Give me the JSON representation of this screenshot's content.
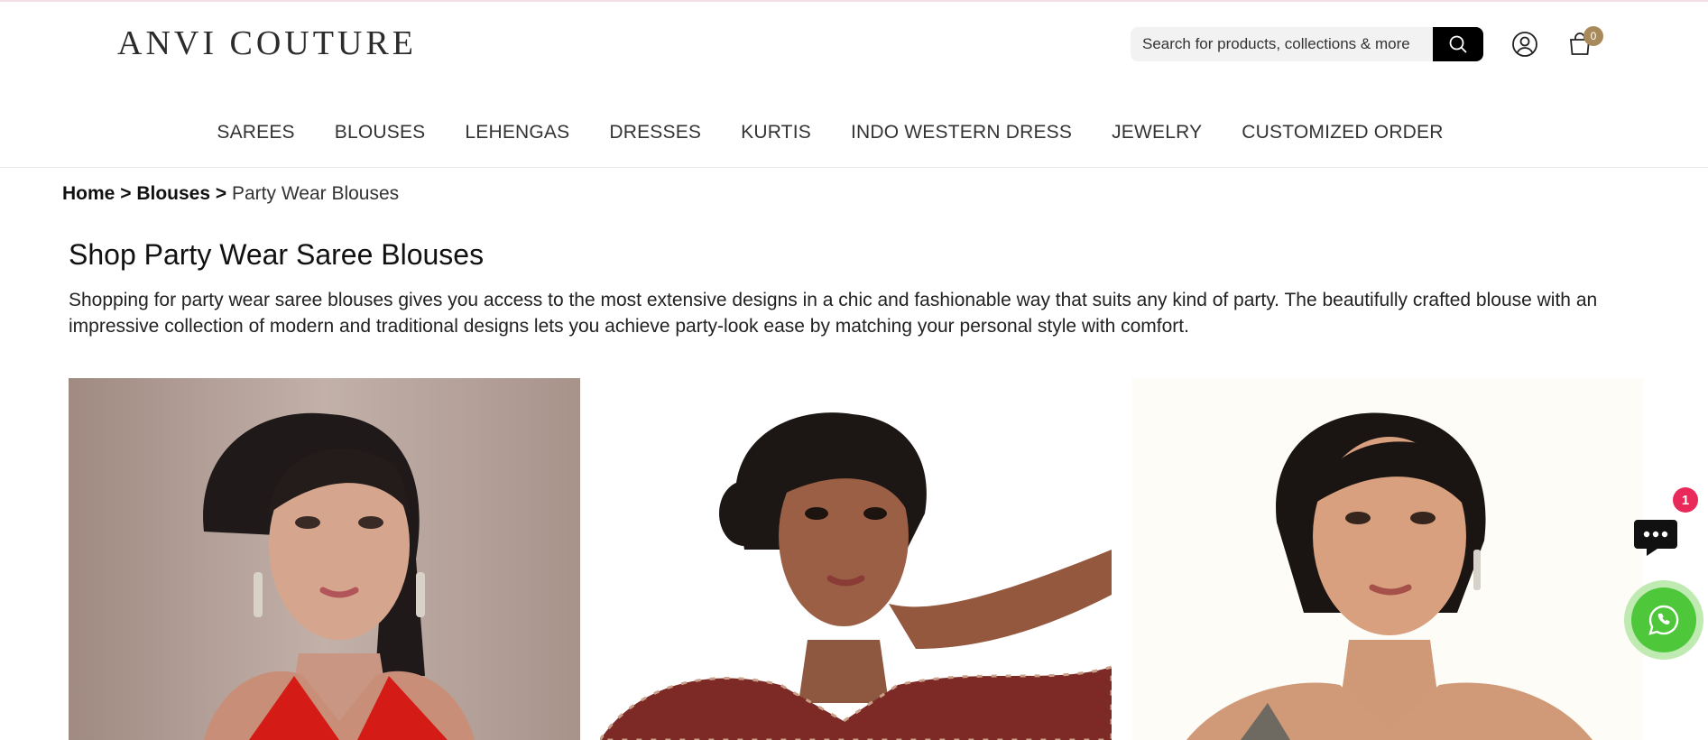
{
  "brand": {
    "logo_text": "ANVI COUTURE"
  },
  "header": {
    "search_placeholder": "Search for products, collections & more",
    "cart_count": "0",
    "icons": {
      "search": "search-icon",
      "account": "user-icon",
      "cart": "shopping-bag-icon"
    },
    "colors": {
      "search_button": "#000000",
      "cart_badge": "#a88a5a"
    }
  },
  "nav": {
    "items": [
      {
        "label": "SAREES"
      },
      {
        "label": "BLOUSES"
      },
      {
        "label": "LEHENGAS"
      },
      {
        "label": "DRESSES"
      },
      {
        "label": "KURTIS"
      },
      {
        "label": "INDO WESTERN DRESS"
      },
      {
        "label": "JEWELRY"
      },
      {
        "label": "CUSTOMIZED ORDER"
      }
    ]
  },
  "breadcrumb": {
    "home": "Home",
    "separator": ">",
    "parent": "Blouses",
    "current": "Party Wear Blouses"
  },
  "page": {
    "title": "Shop Party Wear Saree Blouses",
    "description": "Shopping for party wear saree blouses gives you access to the most extensive designs in a chic and fashionable way that suits any kind of party. The beautifully crafted blouse with an impressive collection of modern and traditional designs lets you achieve party-look ease by matching your personal style with comfort."
  },
  "products": [
    {
      "image": "model-red-blouse-photo"
    },
    {
      "image": "model-printed-blouse-photo"
    },
    {
      "image": "model-grey-blouse-photo"
    }
  ],
  "floating": {
    "chat_badge": "1",
    "chat_icon": "chat-bubble-icon",
    "whatsapp_icon": "whatsapp-icon",
    "colors": {
      "chat_badge": "#e8295a",
      "whatsapp": "#4fc73a"
    }
  }
}
